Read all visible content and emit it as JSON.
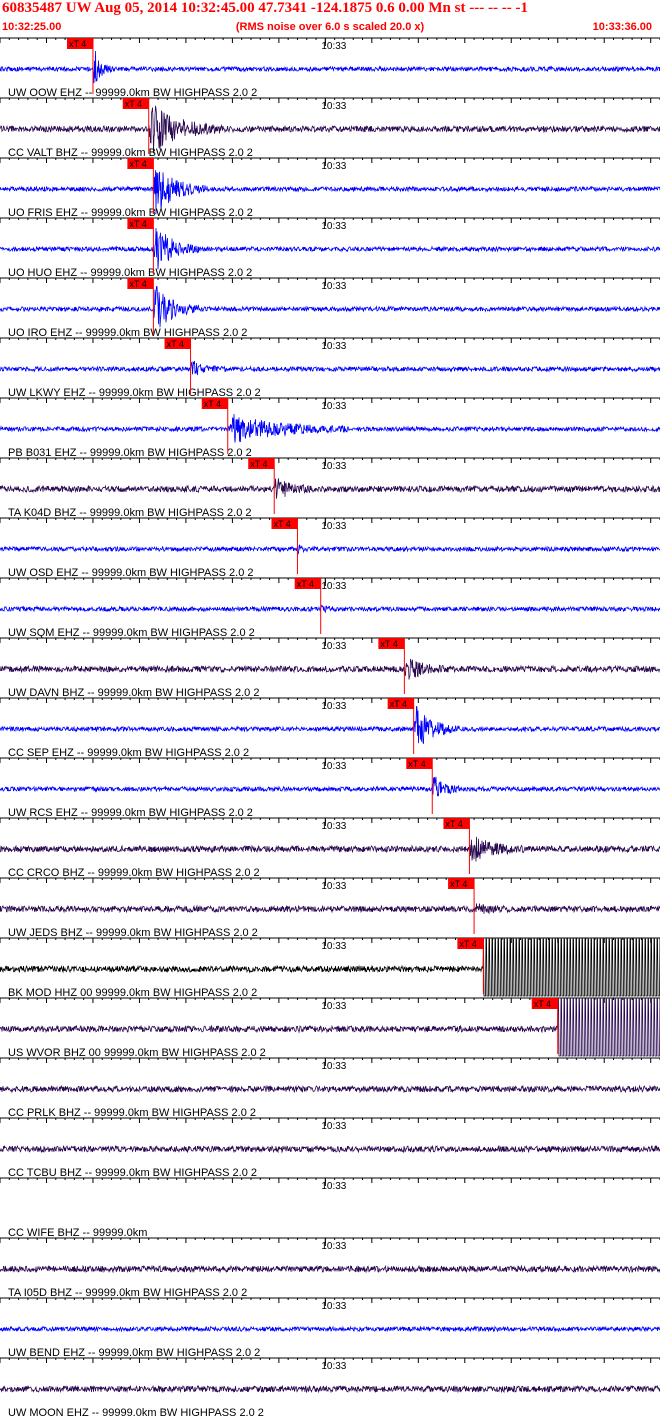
{
  "header": {
    "title": "60835487 UW Aug 05, 2014 10:32:45.00   47.7341 -124.1875  0.6 0.00 Mn st --- -- --  -1",
    "start_time": "10:32:25.00",
    "end_time": "10:33:36.00",
    "noise_note": "(RMS noise over 6.0 s scaled 20.0 x)"
  },
  "colors": {
    "header": "#ff0000",
    "pick": "#ff0000",
    "blue_trace": "#0000ff",
    "purple_trace": "#2a0a50",
    "black_trace": "#000000"
  },
  "chart_data": {
    "type": "line",
    "x_axis": {
      "start": "10:32:25.00",
      "end": "10:33:36.00",
      "minute_tick_label": "10:33"
    },
    "series": [
      {
        "name": "UW OOW EHZ -- 99999.0km BW  HIGHPASS  2.0  2",
        "pick": "xT 4",
        "color": "blue",
        "pick_time_s": 10,
        "onset_s": 10,
        "amp": 0.9,
        "dur": 2
      },
      {
        "name": "CC VALT BHZ -- 99999.0km BW  HIGHPASS  2.0  2",
        "pick": "xT 4",
        "color": "purple",
        "pick_time_s": 16,
        "onset_s": 16,
        "amp": 1.0,
        "dur": 8
      },
      {
        "name": "UO FRIS EHZ -- 99999.0km BW  HIGHPASS  2.0  2",
        "pick": "xT 4",
        "color": "blue",
        "pick_time_s": 16.5,
        "onset_s": 16.5,
        "amp": 1.0,
        "dur": 6
      },
      {
        "name": "UO HUO EHZ -- 99999.0km BW  HIGHPASS  2.0  2",
        "pick": "xT 4",
        "color": "blue",
        "pick_time_s": 16.5,
        "onset_s": 16.5,
        "amp": 1.0,
        "dur": 5
      },
      {
        "name": "UO IRO EHZ -- 99999.0km BW  HIGHPASS  2.0  2",
        "pick": "xT 4",
        "color": "blue",
        "pick_time_s": 16.5,
        "onset_s": 16.5,
        "amp": 1.0,
        "dur": 5
      },
      {
        "name": "UW LKWY EHZ -- 99999.0km BW  HIGHPASS  2.0  2",
        "pick": "xT 4",
        "color": "blue",
        "pick_time_s": 20.5,
        "onset_s": 20.5,
        "amp": 0.3,
        "dur": 4
      },
      {
        "name": "PB B031 EHZ -- 99999.0km BW  HIGHPASS  2.0  2",
        "pick": "xT 4",
        "color": "blue",
        "pick_time_s": 24.5,
        "onset_s": 24.5,
        "amp": 0.55,
        "dur": 14
      },
      {
        "name": "TA K04D BHZ -- 99999.0km BW  HIGHPASS  2.0  2",
        "pick": "xT 4",
        "color": "purple",
        "pick_time_s": 29.5,
        "onset_s": 29.5,
        "amp": 0.45,
        "dur": 4
      },
      {
        "name": "UW OSD EHZ -- 99999.0km BW  HIGHPASS  2.0  2",
        "pick": "xT 4",
        "color": "blue",
        "pick_time_s": 32,
        "onset_s": 32,
        "amp": 0.15,
        "dur": 1
      },
      {
        "name": "UW SQM EHZ -- 99999.0km BW  HIGHPASS  2.0  2",
        "pick": "xT 4",
        "color": "blue",
        "pick_time_s": 34.5,
        "onset_s": 34.5,
        "amp": 0.1,
        "dur": 2
      },
      {
        "name": "UW DAVN BHZ -- 99999.0km BW  HIGHPASS  2.0  2",
        "pick": "xT 4",
        "color": "purple",
        "pick_time_s": 43.5,
        "onset_s": 43.5,
        "amp": 0.4,
        "dur": 5
      },
      {
        "name": "CC SEP EHZ -- 99999.0km BW  HIGHPASS  2.0  2",
        "pick": "xT 4",
        "color": "blue",
        "pick_time_s": 44.5,
        "onset_s": 44.5,
        "amp": 0.9,
        "dur": 5
      },
      {
        "name": "UW RCS EHZ -- 99999.0km BW  HIGHPASS  2.0  2",
        "pick": "xT 4",
        "color": "blue",
        "pick_time_s": 46.5,
        "onset_s": 46.5,
        "amp": 0.55,
        "dur": 3
      },
      {
        "name": "CC CRCO BHZ -- 99999.0km BW  HIGHPASS  2.0  2",
        "pick": "xT 4",
        "color": "purple",
        "pick_time_s": 50.5,
        "onset_s": 50.5,
        "amp": 0.5,
        "dur": 6
      },
      {
        "name": "UW JEDS BHZ -- 99999.0km BW  HIGHPASS  2.0  2",
        "pick": "xT 4",
        "color": "purple",
        "pick_time_s": 51,
        "onset_s": 51,
        "amp": 0.15,
        "dur": 4
      },
      {
        "name": "BK MOD HHZ 00 99999.0km BW  HIGHPASS  2.0  2",
        "pick": "xT 4",
        "color": "black",
        "pick_time_s": 52,
        "onset_s": 52,
        "amp": 1.0,
        "dur": 19,
        "clipped": true
      },
      {
        "name": "US WVOR BHZ 00 99999.0km BW  HIGHPASS  2.0  2",
        "pick": "xT 4",
        "color": "purple",
        "pick_time_s": 60,
        "onset_s": 60,
        "amp": 1.0,
        "dur": 11,
        "clipped": true
      },
      {
        "name": "CC PRLK BHZ -- 99999.0km BW  HIGHPASS  2.0  2",
        "color": "purple",
        "amp": 0,
        "dur": 0
      },
      {
        "name": "CC TCBU BHZ -- 99999.0km BW  HIGHPASS  2.0  2",
        "color": "purple",
        "amp": 0,
        "dur": 0
      },
      {
        "name": "CC WIFE BHZ -- 99999.0km",
        "color": "none",
        "amp": 0,
        "dur": 0,
        "flat": true
      },
      {
        "name": "TA I05D BHZ -- 99999.0km BW  HIGHPASS  2.0  2",
        "color": "purple",
        "amp": 0,
        "dur": 0
      },
      {
        "name": "UW BEND EHZ -- 99999.0km BW  HIGHPASS  2.0  2",
        "color": "blue",
        "amp": 0.12,
        "dur": 0
      },
      {
        "name": "UW MOON EHZ -- 99999.0km BW  HIGHPASS  2.0  2",
        "color": "purple",
        "amp": 0,
        "dur": 0
      }
    ]
  }
}
